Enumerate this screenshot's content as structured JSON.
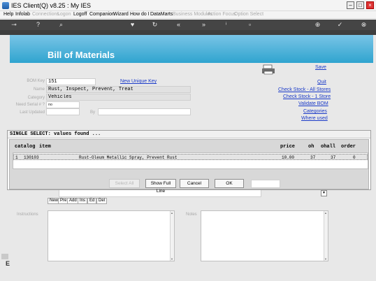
{
  "window": {
    "title": "IES Client(Q) v8.25 : My IES"
  },
  "menu": {
    "items": [
      {
        "label": "Help",
        "enabled": true
      },
      {
        "label": "Infolab",
        "enabled": true
      },
      {
        "label": "Connections",
        "enabled": false
      },
      {
        "label": "Logon",
        "enabled": false
      },
      {
        "label": "Logoff",
        "enabled": true
      },
      {
        "label": "Companion",
        "enabled": true
      },
      {
        "label": "Wizard",
        "enabled": true
      },
      {
        "label": "How do I",
        "enabled": true
      },
      {
        "label": "DataMarts",
        "enabled": true
      },
      {
        "label": "Business Modules",
        "enabled": false
      },
      {
        "label": "Action Focus",
        "enabled": false
      },
      {
        "label": "Option Select",
        "enabled": false
      }
    ]
  },
  "page": {
    "title": "Bill of Materials"
  },
  "form": {
    "bom_key_label": "BOM Key",
    "bom_key_value": "151",
    "new_key_link": "New Unique Key",
    "name_label": "Name",
    "name_value": "Rust, Inspect, Prevent, Treat",
    "category_label": "Category",
    "category_value": "Vehicles",
    "serial_label": "Need Serial # ?",
    "serial_value": "no",
    "last_updated_label": "Last Updated",
    "by_label": "By"
  },
  "actions": {
    "save": "Save",
    "quit": "Quit",
    "check_all": "Check Stock - All Stores",
    "check_one": "Check Stock - 1 Store",
    "validate": "Validate BOM",
    "categories": "Categories",
    "where_used": "Where used"
  },
  "dialog": {
    "title": "SINGLE SELECT: values found ...",
    "columns": {
      "catalog": "catalog",
      "item": "item",
      "price": "price",
      "oh": "oh",
      "ohall": "ohall",
      "order": "order"
    },
    "rows": [
      {
        "num": "1",
        "catalog": "130103",
        "item": "Rust-Oleum Metallic Spray, Prevent Rust",
        "price": "10.00",
        "oh": "37",
        "ohall": "37",
        "order": "0"
      }
    ],
    "buttons": {
      "select_all": "Select All",
      "show_full_line": "Show Full Line",
      "cancel": "Cancel",
      "ok": "OK"
    }
  },
  "grid": {
    "buttons": [
      "New",
      "Pre",
      "Add",
      "Ins",
      "Ed",
      "Del"
    ]
  },
  "memo": {
    "instructions_label": "Instructions",
    "notes_label": "Notes"
  }
}
